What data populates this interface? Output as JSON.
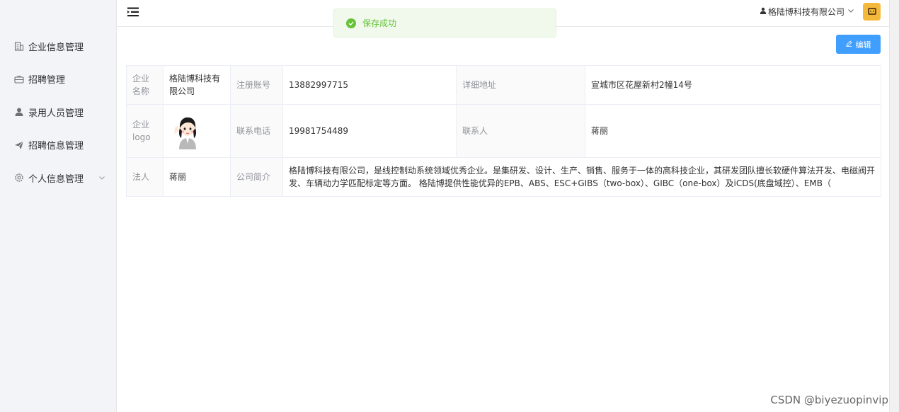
{
  "toast": {
    "message": "保存成功",
    "icon": "check-circle-icon"
  },
  "header": {
    "user_name": "格陆博科技有限公司",
    "caret": "∨"
  },
  "sidebar": {
    "items": [
      {
        "label": "企业信息管理",
        "icon": "building-icon"
      },
      {
        "label": "招聘管理",
        "icon": "briefcase-icon"
      },
      {
        "label": "录用人员管理",
        "icon": "user-icon"
      },
      {
        "label": "招聘信息管理",
        "icon": "send-icon"
      },
      {
        "label": "个人信息管理",
        "icon": "gear-icon",
        "chevron": "∨"
      }
    ]
  },
  "toolbar": {
    "edit_label": "编辑"
  },
  "company": {
    "name_label": "企业名称",
    "name": "格陆博科技有限公司",
    "account_label": "注册账号",
    "account": "13882997715",
    "address_label": "详细地址",
    "address": "宣城市区花屋新村2幢14号",
    "logo_label": "企业logo",
    "phone_label": "联系电话",
    "phone": "19981754489",
    "contact_label": "联系人",
    "contact": "蒋丽",
    "legal_label": "法人",
    "legal": "蒋丽",
    "intro_label": "公司简介",
    "intro": "格陆博科技有限公司，是线控制动系统领域优秀企业。是集研发、设计、生产、销售、服务于一体的高科技企业，其研发团队擅长软硬件算法开发、电磁阀开发、车辆动力学匹配标定等方面。 格陆博提供性能优异的EPB、ABS、ESC+GIBS（two-box）、GIBC（one-box）及iCDS(底盘域控）、EMB（"
  },
  "watermark": "CSDN @biyezuopinvip",
  "colors": {
    "primary": "#409eff",
    "success": "#67c23a",
    "sidebar_bg": "#f2f4f8"
  }
}
